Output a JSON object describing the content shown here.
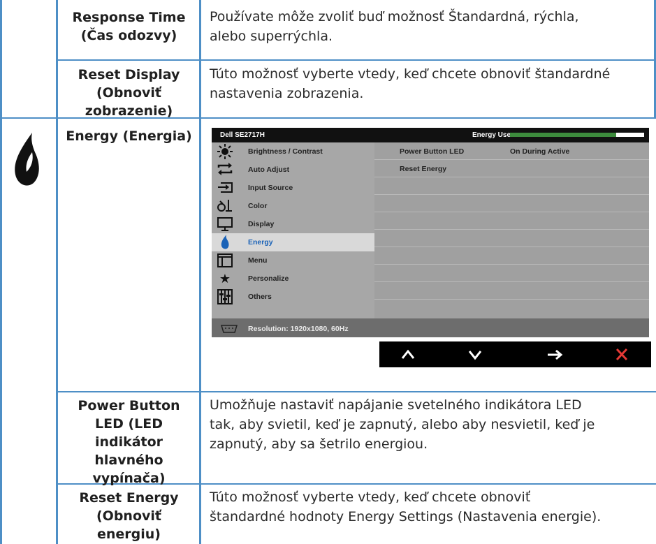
{
  "rows": {
    "response_time": {
      "name": [
        "Response Time",
        "(Čas odozvy)"
      ],
      "desc": [
        "Používate môže zvoliť buď možnosť Štandardná, rýchla,",
        "alebo superrýchla."
      ]
    },
    "reset_display": {
      "name": [
        "Reset Display",
        "(Obnoviť",
        "zobrazenie)"
      ],
      "desc": [
        "Túto možnosť vyberte vtedy, keď chcete obnoviť štandardné",
        "nastavenia zobrazenia."
      ]
    },
    "energy": {
      "name": [
        "Energy (Energia)"
      ]
    },
    "power_button_led": {
      "name": [
        "Power Button",
        "LED (LED",
        "indikátor",
        "hlavného",
        "vypínača)"
      ],
      "desc": [
        "Umožňuje nastaviť napájanie svetelného indikátora LED",
        "tak, aby svietil, keď je zapnutý, alebo aby nesvietil, keď je",
        "zapnutý, aby sa šetrilo energiou."
      ]
    },
    "reset_energy": {
      "name": [
        "Reset Energy",
        "(Obnoviť",
        "energiu)"
      ],
      "desc": [
        "Túto možnosť vyberte vtedy, keď chcete obnoviť",
        "štandardné hodnoty Energy Settings (Nastavenia energie)."
      ]
    }
  },
  "osd": {
    "model": "Dell SE2717H",
    "usage_label": "Energy Use",
    "usage_level": 0.79,
    "menu": [
      {
        "label": "Brightness / Contrast",
        "icon": "sun-icon"
      },
      {
        "label": "Auto Adjust",
        "icon": "auto-adjust-icon"
      },
      {
        "label": "Input Source",
        "icon": "input-source-icon"
      },
      {
        "label": "Color",
        "icon": "color-icon"
      },
      {
        "label": "Display",
        "icon": "display-icon"
      },
      {
        "label": "Energy",
        "icon": "energy-icon",
        "active": true
      },
      {
        "label": "Menu",
        "icon": "menu-icon"
      },
      {
        "label": "Personalize",
        "icon": "star-icon"
      },
      {
        "label": "Others",
        "icon": "others-icon"
      }
    ],
    "settings": [
      {
        "label": "Power Button LED",
        "value": "On During Active"
      },
      {
        "label": "Reset Energy",
        "value": ""
      }
    ],
    "resolution": "Resolution: 1920x1080, 60Hz",
    "buttons": [
      "up-icon",
      "down-icon",
      "right-arrow-icon",
      "close-icon"
    ],
    "colors": {
      "active_text": "#1a62b7",
      "bar_fill": "#3d8b3d",
      "close": "#e53935"
    }
  }
}
